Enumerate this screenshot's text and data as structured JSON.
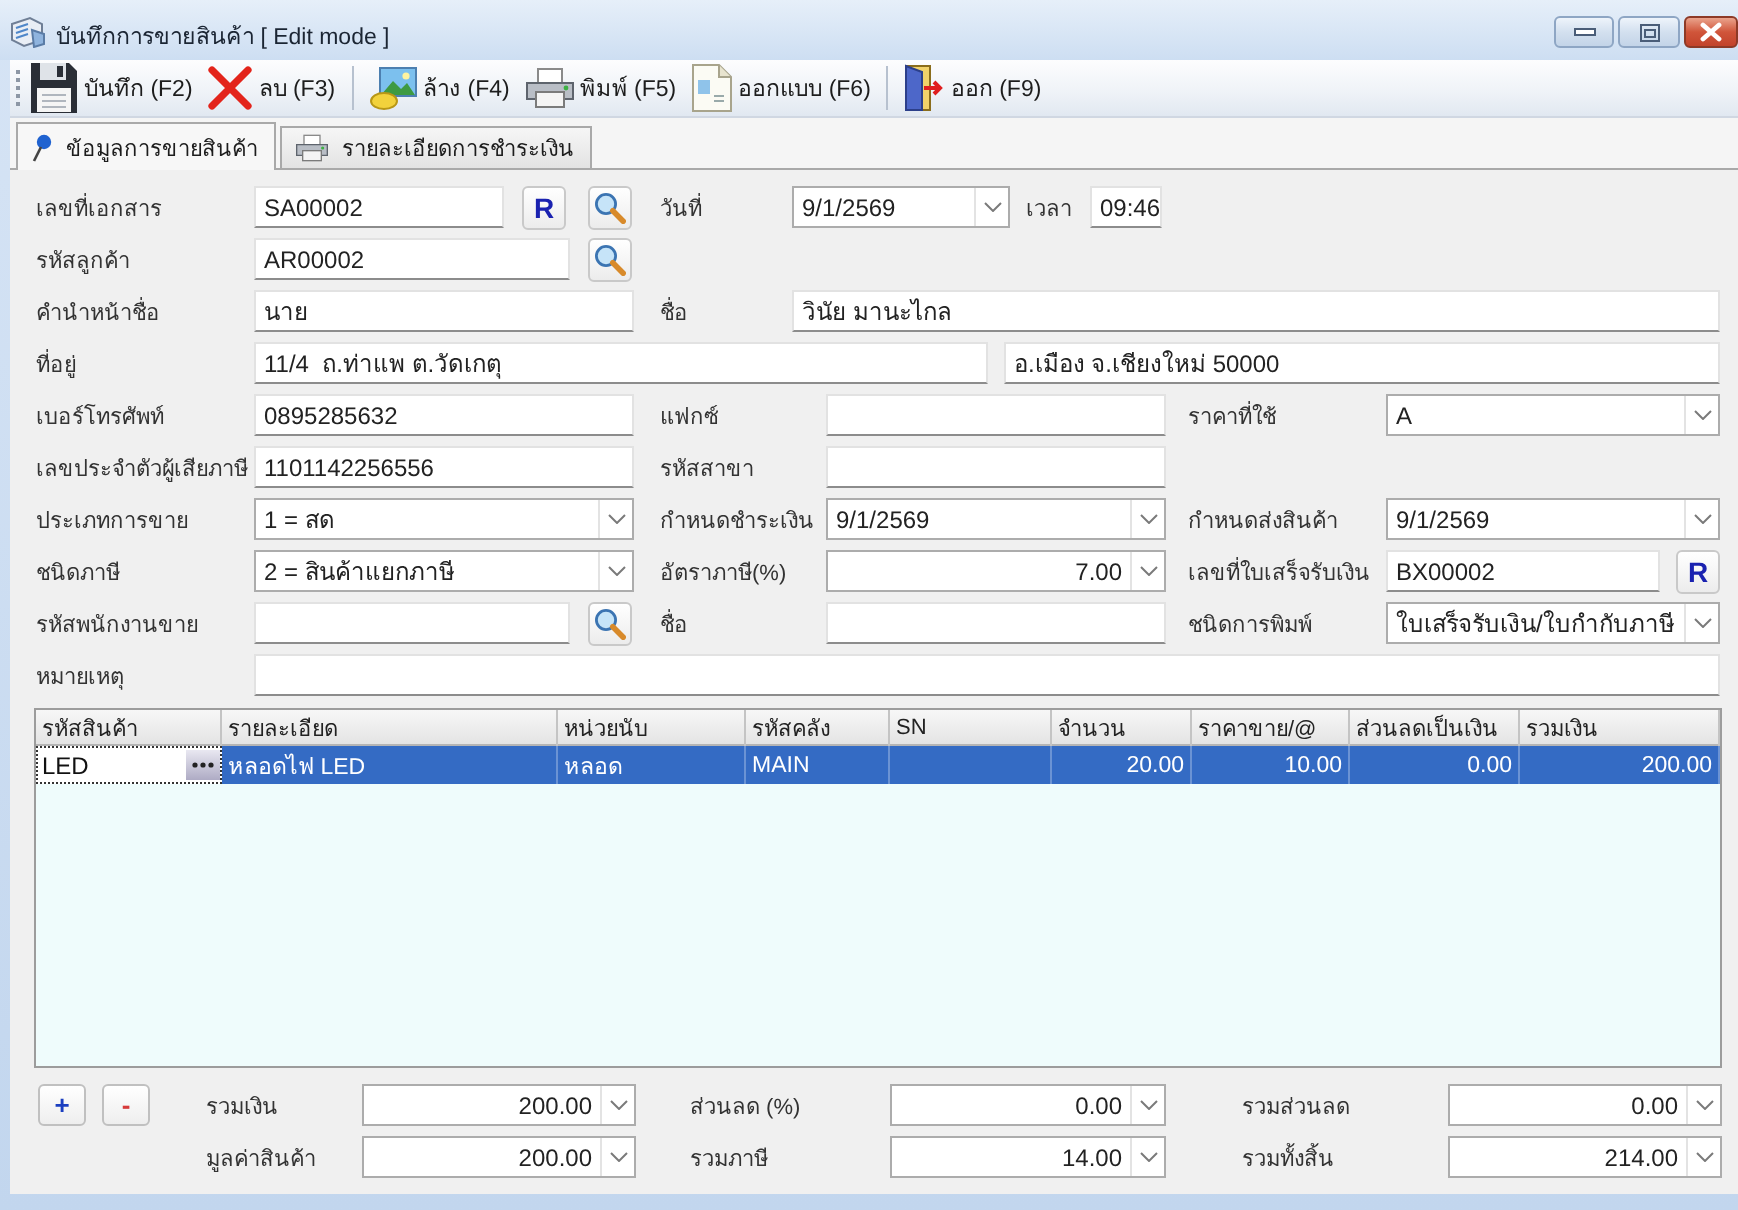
{
  "window": {
    "title": "บันทึกการขายสินค้า [ Edit mode ]"
  },
  "toolbar": [
    [
      {
        "kind": "save",
        "label": "บันทึก (F2)"
      },
      {
        "kind": "delete",
        "label": "ลบ (F3)"
      }
    ],
    [
      {
        "kind": "clear",
        "label": "ล้าง (F4)"
      },
      {
        "kind": "print",
        "label": "พิมพ์ (F5)"
      },
      {
        "kind": "design",
        "label": "ออกแบบ (F6)"
      }
    ],
    [
      {
        "kind": "exit",
        "label": "ออก (F9)"
      }
    ]
  ],
  "tabs": [
    {
      "kind": "sale",
      "label": "ข้อมูลการขายสินค้า",
      "selected": true
    },
    {
      "kind": "payment",
      "label": "รายละเอียดการชำระเงิน",
      "selected": false
    }
  ],
  "form": {
    "document_no": {
      "label": "เลขที่เอกสาร",
      "value": "SA00002",
      "button": "R"
    },
    "date": {
      "label": "วันที่",
      "value": "9/1/2569"
    },
    "time": {
      "label": "เวลา",
      "value": "09:46"
    },
    "customer_code": {
      "label": "รหัสลูกค้า",
      "value": "AR00002"
    },
    "name_prefix": {
      "label": "คำนำหน้าชื่อ",
      "value": "นาย"
    },
    "customer_name": {
      "label": "ชื่อ",
      "value": "วินัย มานะไกล"
    },
    "address": {
      "label": "ที่อยู่",
      "line_1": "11/4  ถ.ท่าแพ ต.วัดเกตุ",
      "line_2": "อ.เมือง จ.เชียงใหม่ 50000"
    },
    "phone": {
      "label": "เบอร์โทรศัพท์",
      "value": "0895285632"
    },
    "fax": {
      "label": "แฟกซ์"
    },
    "price_level": {
      "label": "ราคาที่ใช้",
      "value": "A"
    },
    "tax_id": {
      "label": "เลขประจำตัวผู้เสียภาษี",
      "value": "1101142256556"
    },
    "branch_code": {
      "label": "รหัสสาขา"
    },
    "sale_type": {
      "label": "ประเภทการขาย",
      "value": "1 = สด"
    },
    "payment_due": {
      "label": "กำหนดชำระเงิน",
      "value": "9/1/2569"
    },
    "delivery_date": {
      "label": "กำหนดส่งสินค้า",
      "value": "9/1/2569"
    },
    "tax_type": {
      "label": "ชนิดภาษี",
      "value": "2 = สินค้าแยกภาษี"
    },
    "tax_rate": {
      "label": "อัตราภาษี(%)",
      "value": "7.00"
    },
    "receipt_no": {
      "label": "เลขที่ใบเสร็จรับเงิน",
      "value": "BX00002",
      "button": "R"
    },
    "salesperson_code": {
      "label": "รหัสพนักงานขาย"
    },
    "salesperson_name": {
      "label": "ชื่อ"
    },
    "print_type": {
      "label": "ชนิดการพิมพ์",
      "value": "ใบเสร็จรับเงิน/ใบกำกับภาษี"
    },
    "remark": {
      "label": "หมายเหตุ"
    }
  },
  "table": {
    "columns": [
      "รหัสสินค้า",
      "รายละเอียด",
      "หน่วยนับ",
      "รหัสคลัง",
      "SN",
      "จำนวน",
      "ราคาขาย/@",
      "ส่วนลดเป็นเงิน",
      "รวมเงิน"
    ],
    "rows": [
      {
        "product_code": "LED",
        "description": "หลอดไฟ LED",
        "unit": "หลอด",
        "warehouse": "MAIN",
        "quantity": "20.00",
        "unit_price": "10.00",
        "discount": "0.00",
        "amount": "200.00",
        "selected": true
      }
    ]
  },
  "footer": {
    "buttons": [
      {
        "kind": "add",
        "label": "+"
      },
      {
        "kind": "remove",
        "label": "-"
      }
    ],
    "totals": [
      {
        "label": "รวมเงิน",
        "value": "200.00"
      },
      {
        "label": "ส่วนลด (%)",
        "value": "0.00"
      },
      {
        "label": "รวมส่วนลด",
        "value": "0.00"
      },
      {
        "label": "มูลค่าสินค้า",
        "value": "200.00"
      },
      {
        "label": "รวมภาษี",
        "value": "14.00"
      },
      {
        "label": "รวมทั้งสิ้น",
        "value": "214.00"
      }
    ]
  }
}
